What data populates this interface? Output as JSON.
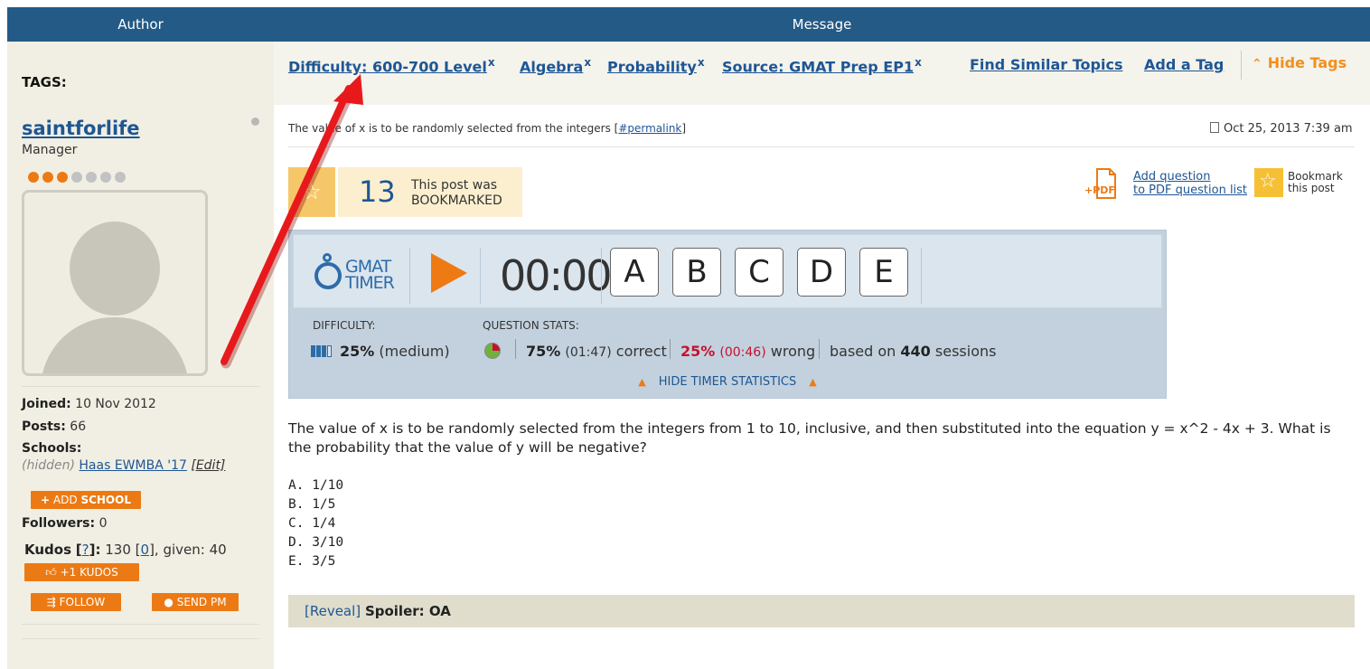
{
  "header": {
    "author": "Author",
    "message": "Message"
  },
  "tags": {
    "label": "TAGS:",
    "items": [
      {
        "label": "Difficulty: 600-700 Level",
        "remove": "x"
      },
      {
        "label": "Algebra",
        "remove": "x"
      },
      {
        "label": "Probability",
        "remove": "x"
      },
      {
        "label": "Source: GMAT Prep EP1",
        "remove": "x"
      }
    ],
    "find_similar": "Find Similar Topics",
    "add_tag": "Add a Tag",
    "hide_tags": "Hide Tags"
  },
  "author": {
    "username": "saintforlife",
    "role": "Manager",
    "rank_filled": 3,
    "rank_total": 7,
    "joined_label": "Joined:",
    "joined_value": "10 Nov 2012",
    "posts_label": "Posts:",
    "posts_value": "66",
    "schools_label": "Schools:",
    "schools_hidden": "(hidden)",
    "school_name": "Haas EWMBA '17",
    "school_edit": "[Edit]",
    "add_school_plus": "+",
    "add_school_prefix": "ADD",
    "add_school_word": "SCHOOL",
    "followers_label": "Followers:",
    "followers_value": "0",
    "kudos_label": "Kudos",
    "kudos_help": "?",
    "kudos_value": "130",
    "kudos_zero": "0",
    "kudos_given": "given: 40",
    "kudos_button": "+1 KUDOS",
    "follow_button": "FOLLOW",
    "send_pm_button": "SEND PM"
  },
  "post": {
    "title": "The value of x is to be randomly selected from the integers",
    "permalink": "#permalink",
    "date": "Oct 25, 2013 7:39 am",
    "bookmark_count": "13",
    "bookmark_text_1": "This post was",
    "bookmark_text_2": "BOOKMARKED",
    "pdf_link_1": "Add question",
    "pdf_link_2": "to PDF question list",
    "pdf_icon_label": "+PDF",
    "bookmark_link_1": "Bookmark",
    "bookmark_link_2": "this post",
    "question": "The value of x is to be randomly selected from the integers from 1 to 10, inclusive, and then substituted into the equation y = x^2 - 4x + 3. What is the probability that the value of y will be negative?",
    "options": [
      "A. 1/10",
      "B. 1/5",
      "C. 1/4",
      "D. 3/10",
      "E. 3/5"
    ],
    "spoiler_reveal": "[Reveal]",
    "spoiler_text": "Spoiler: OA"
  },
  "timer": {
    "logo_line1": "GMAT",
    "logo_line2": "TIMER",
    "clock": "00:00",
    "answers": [
      "A",
      "B",
      "C",
      "D",
      "E"
    ],
    "difficulty_label": "DIFFICULTY:",
    "difficulty_value": "25%",
    "difficulty_level": 0.25,
    "difficulty_text": "(medium)",
    "stats_label": "QUESTION STATS:",
    "correct_pct": "75%",
    "correct_time": "(01:47)",
    "correct_word": "correct",
    "wrong_pct": "25%",
    "wrong_time": "(00:46)",
    "wrong_word": "wrong",
    "based_on": "based on",
    "sessions_count": "440",
    "sessions_word": "sessions",
    "hide_stats": "HIDE TIMER STATISTICS"
  },
  "colors": {
    "header_bg": "#235a86",
    "link": "#1e5694",
    "accent_orange": "#ec7a14",
    "annotation_arrow": "#e8191c"
  }
}
